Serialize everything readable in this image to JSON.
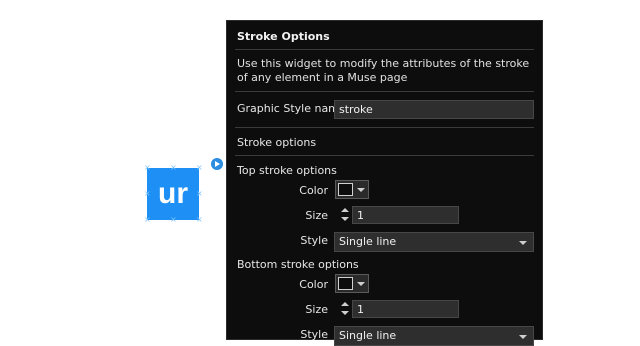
{
  "canvas": {
    "widget_text": "ur",
    "options_icon": "play-circle-icon",
    "widget_color": "#1e90f5"
  },
  "panel": {
    "title": "Stroke Options",
    "description": "Use this widget to modify the attributes of the stroke of any element in a Muse page",
    "graphic_style": {
      "label": "Graphic Style name",
      "value": "stroke"
    },
    "stroke_options_label": "Stroke options",
    "top": {
      "heading": "Top stroke options",
      "color_label": "Color",
      "size_label": "Size",
      "size_value": "1",
      "style_label": "Style",
      "style_value": "Single line"
    },
    "bottom": {
      "heading": "Bottom stroke options",
      "color_label": "Color",
      "size_label": "Size",
      "size_value": "1",
      "style_label": "Style",
      "style_value": "Single line"
    }
  }
}
